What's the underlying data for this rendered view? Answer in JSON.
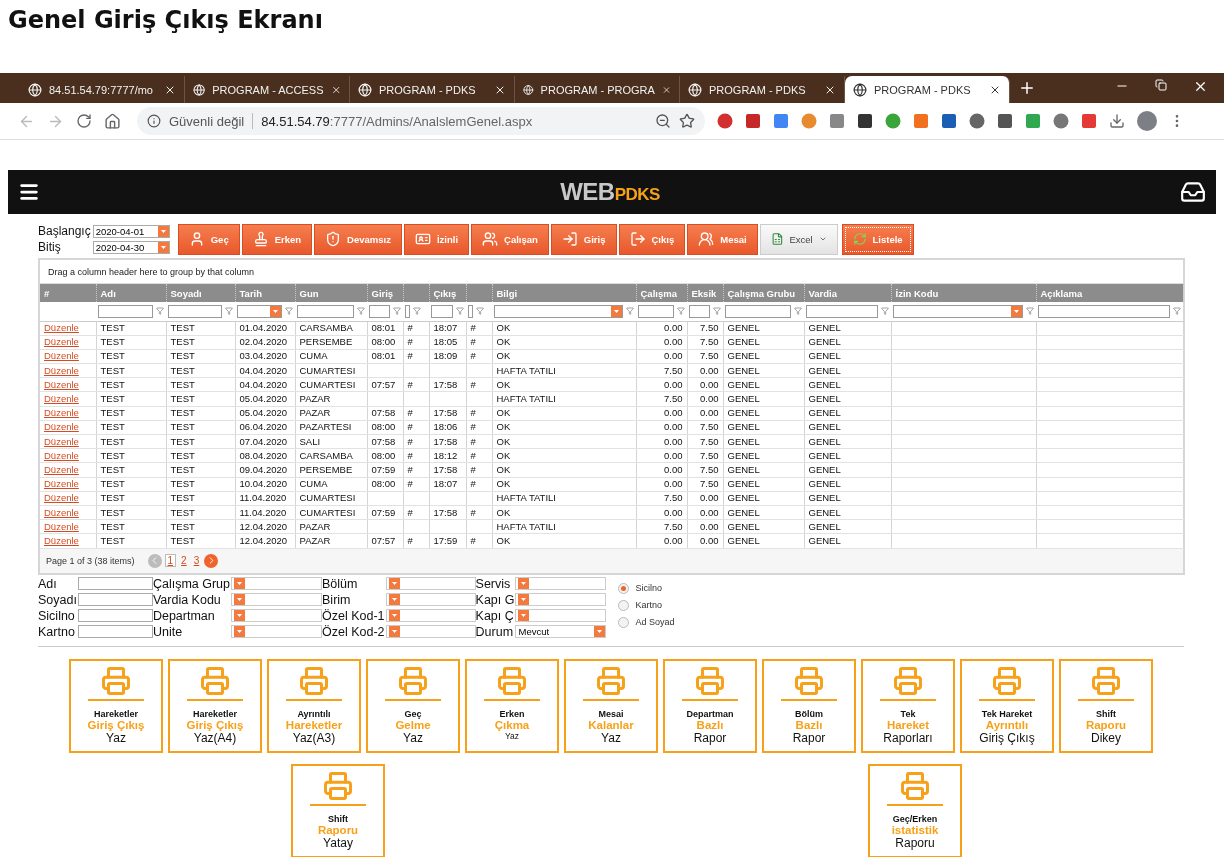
{
  "page_title": "Genel Giriş Çıkış Ekranı",
  "browser": {
    "tabs": [
      {
        "title": "84.51.54.79:7777/mo",
        "selected": false
      },
      {
        "title": "PROGRAM - ACCESS",
        "selected": false
      },
      {
        "title": "PROGRAM - PDKS",
        "selected": false
      },
      {
        "title": "PROGRAM - PROGRA",
        "selected": false
      },
      {
        "title": "PROGRAM - PDKS",
        "selected": false
      },
      {
        "title": "PROGRAM - PDKS",
        "selected": true
      }
    ],
    "security": "Güvenli değil",
    "url_host": "84.51.54.79",
    "url_path": ":7777/Admins/AnalslemGenel.aspx"
  },
  "navbar": {
    "logo_primary": "WEB",
    "logo_secondary": "PDKS"
  },
  "dates": [
    {
      "label": "Başlangıç",
      "value": "2020-04-01"
    },
    {
      "label": "Bitiş",
      "value": "2020-04-30"
    }
  ],
  "actions": [
    {
      "label": "Geç",
      "kind": "plain"
    },
    {
      "label": "Erken",
      "kind": "plain"
    },
    {
      "label": "Devamsız",
      "kind": "plain"
    },
    {
      "label": "İzinli",
      "kind": "plain"
    },
    {
      "label": "Çalışan",
      "kind": "plain"
    },
    {
      "label": "Giriş",
      "kind": "plain"
    },
    {
      "label": "Çıkış",
      "kind": "plain"
    },
    {
      "label": "Mesai",
      "kind": "plain"
    },
    {
      "label": "Excel",
      "kind": "menu"
    },
    {
      "label": "Listele",
      "kind": "focused"
    }
  ],
  "grid": {
    "group_hint": "Drag a column header here to group by that column",
    "columns": [
      {
        "label": "#",
        "kind": "link"
      },
      {
        "label": "Adı",
        "filter": {
          "kind": "text"
        }
      },
      {
        "label": "Soyadı",
        "filter": {
          "kind": "text"
        }
      },
      {
        "label": "Tarih",
        "filter": {
          "kind": "dropdown"
        }
      },
      {
        "label": "Gun",
        "filter": {
          "kind": "text"
        }
      },
      {
        "label": "Giriş",
        "filter": {
          "kind": "text"
        }
      },
      {
        "filter": {
          "kind": "check",
          "checked": false
        }
      },
      {
        "label": "Çıkış",
        "filter": {
          "kind": "text"
        }
      },
      {
        "filter": {
          "kind": "check",
          "checked": false
        }
      },
      {
        "label": "Bilgi",
        "filter": {
          "kind": "dropdown"
        }
      },
      {
        "label": "Çalışma",
        "kind": "number",
        "filter": {
          "kind": "text"
        }
      },
      {
        "label": "Eksik",
        "kind": "number",
        "filter": {
          "kind": "text"
        }
      },
      {
        "label": "Çalışma Grubu",
        "filter": {
          "kind": "text"
        }
      },
      {
        "label": "Vardia",
        "filter": {
          "kind": "text"
        }
      },
      {
        "label": "İzin Kodu",
        "filter": {
          "kind": "dropdown"
        }
      },
      {
        "label": "Açıklama",
        "filter": {
          "kind": "text"
        }
      }
    ],
    "rows": [
      [
        "Düzenle",
        "TEST",
        "TEST",
        "01.04.2020",
        "CARSAMBA",
        "08:01",
        "#",
        "18:07",
        "#",
        "OK",
        "0.00",
        "7.50",
        "GENEL",
        "GENEL"
      ],
      [
        "Düzenle",
        "TEST",
        "TEST",
        "02.04.2020",
        "PERSEMBE",
        "08:00",
        "#",
        "18:05",
        "#",
        "OK",
        "0.00",
        "7.50",
        "GENEL",
        "GENEL"
      ],
      [
        "Düzenle",
        "TEST",
        "TEST",
        "03.04.2020",
        "CUMA",
        "08:01",
        "#",
        "18:09",
        "#",
        "OK",
        "0.00",
        "7.50",
        "GENEL",
        "GENEL"
      ],
      [
        "Düzenle",
        "TEST",
        "TEST",
        "04.04.2020",
        "CUMARTESI",
        null,
        null,
        null,
        null,
        "HAFTA TATILI",
        "7.50",
        "0.00",
        "GENEL",
        "GENEL"
      ],
      [
        "Düzenle",
        "TEST",
        "TEST",
        "04.04.2020",
        "CUMARTESI",
        "07:57",
        "#",
        "17:58",
        "#",
        "OK",
        "0.00",
        "0.00",
        "GENEL",
        "GENEL"
      ],
      [
        "Düzenle",
        "TEST",
        "TEST",
        "05.04.2020",
        "PAZAR",
        null,
        null,
        null,
        null,
        "HAFTA TATILI",
        "7.50",
        "0.00",
        "GENEL",
        "GENEL"
      ],
      [
        "Düzenle",
        "TEST",
        "TEST",
        "05.04.2020",
        "PAZAR",
        "07:58",
        "#",
        "17:58",
        "#",
        "OK",
        "0.00",
        "0.00",
        "GENEL",
        "GENEL"
      ],
      [
        "Düzenle",
        "TEST",
        "TEST",
        "06.04.2020",
        "PAZARTESI",
        "08:00",
        "#",
        "18:06",
        "#",
        "OK",
        "0.00",
        "7.50",
        "GENEL",
        "GENEL"
      ],
      [
        "Düzenle",
        "TEST",
        "TEST",
        "07.04.2020",
        "SALI",
        "07:58",
        "#",
        "17:58",
        "#",
        "OK",
        "0.00",
        "7.50",
        "GENEL",
        "GENEL"
      ],
      [
        "Düzenle",
        "TEST",
        "TEST",
        "08.04.2020",
        "CARSAMBA",
        "08:00",
        "#",
        "18:12",
        "#",
        "OK",
        "0.00",
        "7.50",
        "GENEL",
        "GENEL"
      ],
      [
        "Düzenle",
        "TEST",
        "TEST",
        "09.04.2020",
        "PERSEMBE",
        "07:59",
        "#",
        "17:58",
        "#",
        "OK",
        "0.00",
        "7.50",
        "GENEL",
        "GENEL"
      ],
      [
        "Düzenle",
        "TEST",
        "TEST",
        "10.04.2020",
        "CUMA",
        "08:00",
        "#",
        "18:07",
        "#",
        "OK",
        "0.00",
        "7.50",
        "GENEL",
        "GENEL"
      ],
      [
        "Düzenle",
        "TEST",
        "TEST",
        "11.04.2020",
        "CUMARTESI",
        null,
        null,
        null,
        null,
        "HAFTA TATILI",
        "7.50",
        "0.00",
        "GENEL",
        "GENEL"
      ],
      [
        "Düzenle",
        "TEST",
        "TEST",
        "11.04.2020",
        "CUMARTESI",
        "07:59",
        "#",
        "17:58",
        "#",
        "OK",
        "0.00",
        "0.00",
        "GENEL",
        "GENEL"
      ],
      [
        "Düzenle",
        "TEST",
        "TEST",
        "12.04.2020",
        "PAZAR",
        null,
        null,
        null,
        null,
        "HAFTA TATILI",
        "7.50",
        "0.00",
        "GENEL",
        "GENEL"
      ],
      [
        "Düzenle",
        "TEST",
        "TEST",
        "12.04.2020",
        "PAZAR",
        "07:57",
        "#",
        "17:59",
        "#",
        "OK",
        "0.00",
        "0.00",
        "GENEL",
        "GENEL"
      ]
    ],
    "pager": {
      "summary": "Page 1 of 3 (38 items)",
      "prev_disabled": true,
      "next_disabled": false,
      "pages": [
        {
          "label": "1",
          "selected": true
        },
        {
          "label": "2",
          "selected": false
        },
        {
          "label": "3",
          "selected": false
        }
      ]
    }
  },
  "filters": [
    [
      {
        "label": "Adı",
        "kind": "text"
      },
      {
        "label": "Soyadı",
        "kind": "text"
      },
      {
        "label": "Sicilno",
        "kind": "text"
      },
      {
        "label": "Kartno",
        "kind": "text"
      }
    ],
    [
      {
        "label": "Çalışma Grup",
        "kind": "select"
      },
      {
        "label": "Vardia Kodu",
        "kind": "select"
      },
      {
        "label": "Departman",
        "kind": "select"
      },
      {
        "label": "Unite",
        "kind": "select"
      }
    ],
    [
      {
        "label": "Bölüm",
        "kind": "select"
      },
      {
        "label": "Birim",
        "kind": "select"
      },
      {
        "label": "Özel Kod-1",
        "kind": "select"
      },
      {
        "label": "Özel Kod-2",
        "kind": "select"
      }
    ],
    [
      {
        "label": "Servis",
        "kind": "select"
      },
      {
        "label": "Kapı G",
        "kind": "select"
      },
      {
        "label": "Kapı Ç",
        "kind": "select"
      },
      {
        "label": "Durum",
        "kind": "select",
        "value": "Mevcut"
      }
    ]
  ],
  "search_by": [
    {
      "label": "Sicilno",
      "selected": true
    },
    {
      "label": "Kartno",
      "selected": false
    },
    {
      "label": "Ad Soyad",
      "selected": false
    }
  ],
  "reports": [
    [
      {
        "top": "Hareketler",
        "accent": "Giriş Çıkış",
        "bottom": "Yaz",
        "bottom_small": false
      },
      {
        "top": "Hareketler",
        "accent": "Giriş Çıkış",
        "bottom": "Yaz(A4)",
        "bottom_small": false
      },
      {
        "top": "Ayrıntılı",
        "accent": "Hareketler",
        "bottom": "Yaz(A3)",
        "bottom_small": false
      },
      {
        "top": "Geç",
        "accent": "Gelme",
        "bottom": "Yaz",
        "bottom_small": false
      },
      {
        "top": "Erken",
        "accent": "Çıkma",
        "bottom": "Yaz",
        "bottom_small": true
      },
      {
        "top": "Mesai",
        "accent": "Kalanlar",
        "bottom": "Yaz",
        "bottom_small": false
      },
      {
        "top": "Departman",
        "accent": "Bazlı",
        "bottom": "Rapor",
        "bottom_small": false
      },
      {
        "top": "Bölüm",
        "accent": "Bazlı",
        "bottom": "Rapor",
        "bottom_small": false
      },
      {
        "top": "Tek",
        "accent": "Hareket",
        "bottom": "Raporları",
        "bottom_small": false
      },
      {
        "top": "Tek Hareket",
        "accent": "Ayrıntılı",
        "bottom": "Giriş Çıkış",
        "bottom_small": false
      },
      {
        "top": "Shift",
        "accent": "Raporu",
        "bottom": "Dikey",
        "bottom_small": false
      }
    ],
    [
      {
        "top": "Shift",
        "accent": "Raporu",
        "bottom": "Yatay",
        "bottom_small": false
      },
      {
        "top": "Geç/Erken",
        "accent": "istatistik",
        "bottom": "Raporu",
        "bottom_small": false
      }
    ]
  ]
}
